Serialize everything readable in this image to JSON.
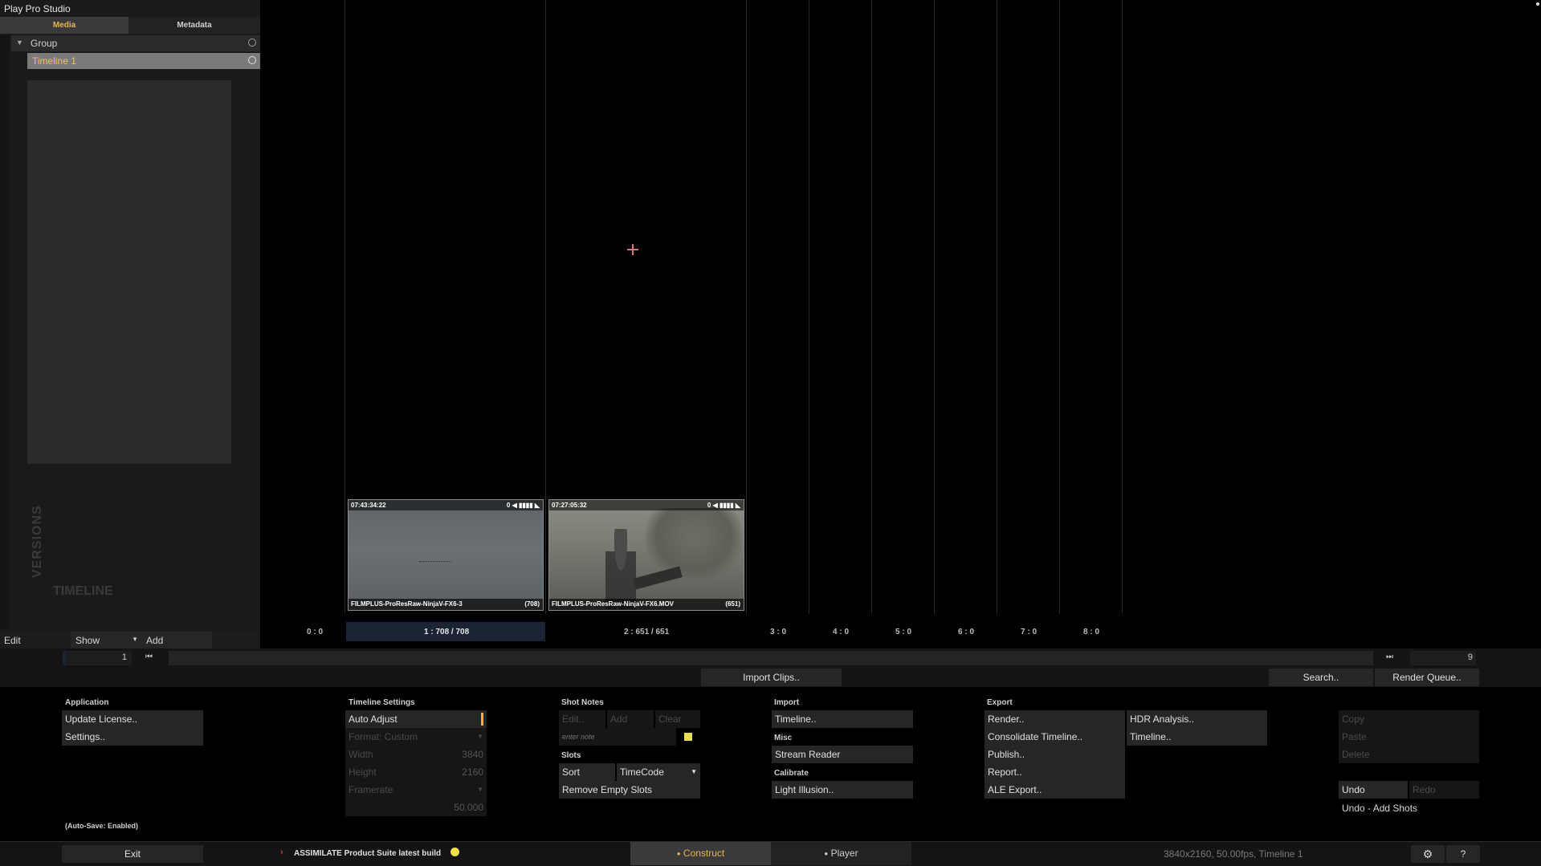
{
  "app": {
    "title": "Play Pro Studio"
  },
  "left_panel": {
    "tabs": [
      {
        "label": "Media",
        "active": true
      },
      {
        "label": "Metadata",
        "active": false
      }
    ],
    "tree": {
      "group_label": "Group",
      "timeline_label": "Timeline 1"
    },
    "vertical_labels": {
      "versions": "VERSIONS",
      "timeline": "TIMELINE"
    },
    "toolbar": {
      "edit": "Edit",
      "show": "Show",
      "add": "Add"
    }
  },
  "timeline": {
    "clips": [
      {
        "timecode": "07:43:34:22",
        "audio": "0",
        "name": "FILMPLUS-ProResRaw-NinjaV-FX6-3",
        "frames": "(708)"
      },
      {
        "timecode": "07:27:05:32",
        "audio": "0",
        "name": "FILMPLUS-ProResRaw-NinjaV-FX6.MOV",
        "frames": "(651)"
      }
    ],
    "ruler": {
      "t0": "0 : 0",
      "t1": "1 : 708 / 708",
      "t2": "2 : 651 / 651",
      "t3": "3 : 0",
      "t4": "4 : 0",
      "t5": "5 : 0",
      "t6": "6 : 0",
      "t7": "7 : 0",
      "t8": "8 : 0"
    },
    "nav": {
      "start_value": "1",
      "end_value": "9"
    }
  },
  "actions": {
    "import_clips": "Import Clips..",
    "search": "Search..",
    "render_queue": "Render Queue.."
  },
  "application": {
    "title": "Application",
    "update_license": "Update License..",
    "settings": "Settings..",
    "autosave": "(Auto-Save: Enabled)"
  },
  "timeline_settings": {
    "title": "Timeline Settings",
    "auto_adjust": "Auto Adjust",
    "format": "Format: Custom",
    "width_label": "Width",
    "width_value": "3840",
    "height_label": "Height",
    "height_value": "2160",
    "framerate_label": "Framerate",
    "framerate_value": "50.000"
  },
  "shot_notes": {
    "title": "Shot Notes",
    "edit": "Edit..",
    "add": "Add",
    "clear": "Clear",
    "placeholder": "enter note",
    "slots_title": "Slots",
    "sort": "Sort",
    "sort_value": "TimeCode",
    "remove_empty": "Remove Empty Slots"
  },
  "import": {
    "title": "Import",
    "timeline": "Timeline..",
    "misc_title": "Misc",
    "stream_reader": "Stream Reader",
    "calibrate_title": "Calibrate",
    "light_illusion": "Light Illusion.."
  },
  "export": {
    "title": "Export",
    "render": "Render..",
    "consolidate": "Consolidate Timeline..",
    "publish": "Publish..",
    "report": "Report..",
    "ale_export": "ALE Export..",
    "hdr_analysis": "HDR Analysis..",
    "timeline": "Timeline.."
  },
  "edit_ops": {
    "copy": "Copy",
    "paste": "Paste",
    "delete": "Delete",
    "undo": "Undo",
    "redo": "Redo",
    "undo_info": "Undo - Add Shots"
  },
  "status_bar": {
    "exit": "Exit",
    "news": "ASSIMILATE Product Suite latest build",
    "construct": "Construct",
    "player": "Player",
    "info": "3840x2160, 50.00fps, Timeline 1",
    "help": "?"
  },
  "colors": {
    "accent": "#e8b54a",
    "note_swatch": "#e8e04a",
    "ruler_active": "#1b2433"
  }
}
